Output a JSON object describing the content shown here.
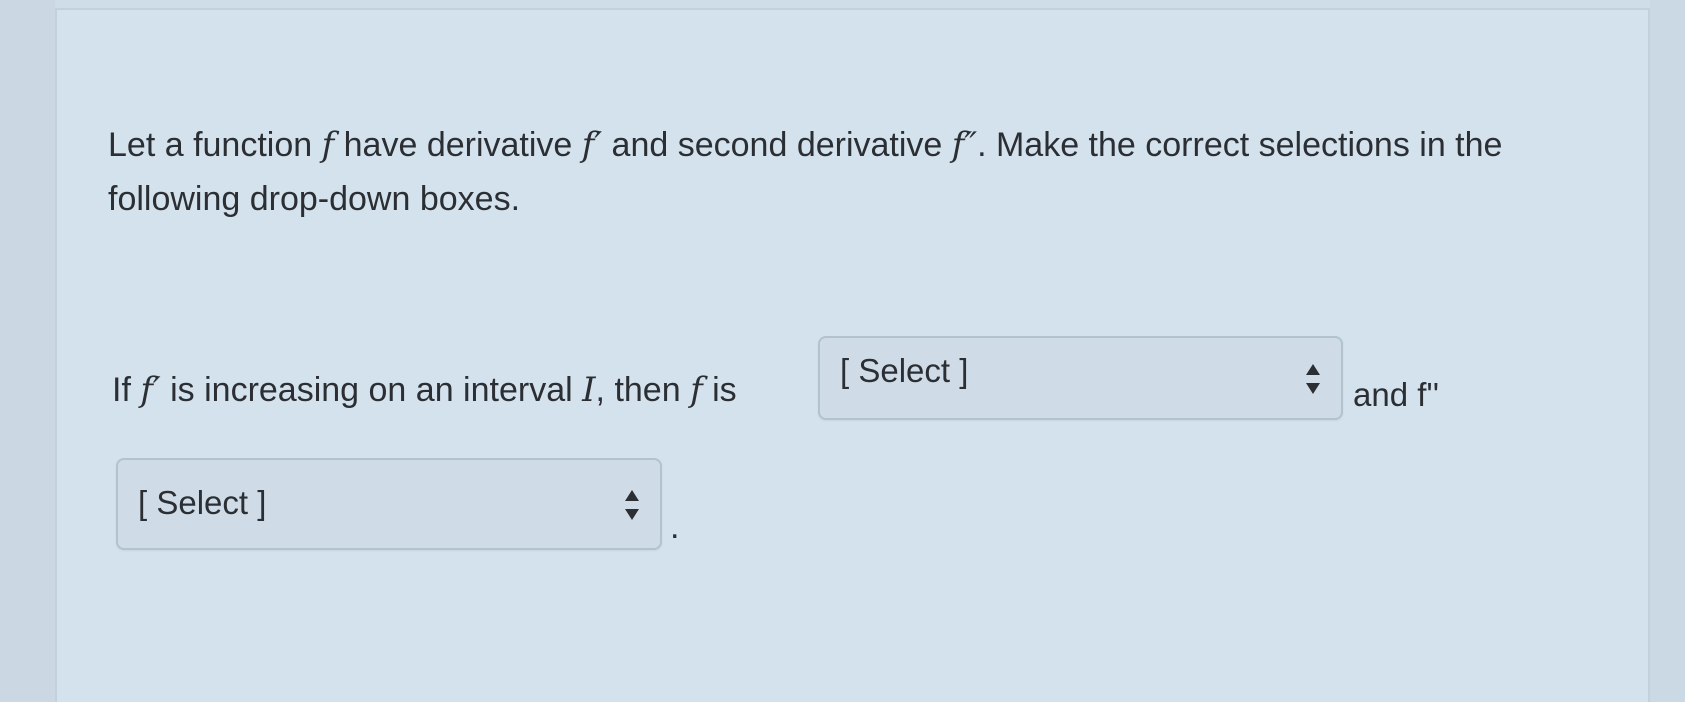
{
  "question": {
    "part1": "Let a function ",
    "f1": "f",
    "part2": " have derivative ",
    "f2": "f′",
    "part3": " and second derivative ",
    "f3": "f″",
    "part4": ". Make the correct selections in the following drop-down boxes."
  },
  "statement": {
    "if": "If ",
    "fprime": "f′",
    "mid1": " is increasing on an interval ",
    "interval": "I",
    "mid2": ", then ",
    "f": "f",
    "mid3": " is"
  },
  "select1": {
    "value": "[ Select ]"
  },
  "after_select1": "and f''",
  "select2": {
    "value": "[ Select ]"
  },
  "end_period": ".",
  "icons": {
    "select_arrows": "updown-arrows-icon"
  },
  "colors": {
    "background": "#cfdde8",
    "text": "#2b2f33",
    "select_border": "#b3c2cf"
  }
}
